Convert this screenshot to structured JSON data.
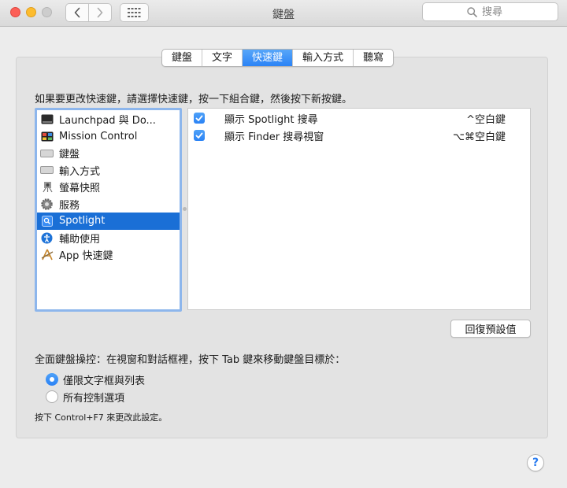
{
  "window": {
    "title": "鍵盤",
    "search_placeholder": "搜尋"
  },
  "tabs": [
    {
      "label": "鍵盤",
      "active": false
    },
    {
      "label": "文字",
      "active": false
    },
    {
      "label": "快速鍵",
      "active": true
    },
    {
      "label": "輸入方式",
      "active": false
    },
    {
      "label": "聽寫",
      "active": false
    }
  ],
  "instruction": "如果要更改快速鍵，請選擇快速鍵，按一下組合鍵，然後按下新按鍵。",
  "categories": [
    {
      "label": "Launchpad 與 Do...",
      "icon": "launchpad-icon",
      "selected": false
    },
    {
      "label": "Mission Control",
      "icon": "mission-control-icon",
      "selected": false
    },
    {
      "label": "鍵盤",
      "icon": "keyboard-icon",
      "selected": false
    },
    {
      "label": "輸入方式",
      "icon": "input-method-icon",
      "selected": false
    },
    {
      "label": "螢幕快照",
      "icon": "screenshot-icon",
      "selected": false
    },
    {
      "label": "服務",
      "icon": "services-gear-icon",
      "selected": false
    },
    {
      "label": "Spotlight",
      "icon": "spotlight-icon",
      "selected": true
    },
    {
      "label": "輔助使用",
      "icon": "accessibility-icon",
      "selected": false
    },
    {
      "label": "App 快速鍵",
      "icon": "app-shortcuts-icon",
      "selected": false
    }
  ],
  "shortcuts": [
    {
      "checked": true,
      "label": "顯示 Spotlight 搜尋",
      "key": "^空白鍵"
    },
    {
      "checked": true,
      "label": "顯示 Finder 搜尋視窗",
      "key": "⌥⌘空白鍵"
    }
  ],
  "restore_defaults_label": "回復預設值",
  "full_keyboard_access": {
    "label": "全面鍵盤操控：在視窗和對話框裡，按下 Tab 鍵來移動鍵盤目標於：",
    "options": [
      {
        "label": "僅限文字框與列表",
        "selected": true
      },
      {
        "label": "所有控制選項",
        "selected": false
      }
    ],
    "note": "按下 Control+F7 來更改此設定。"
  },
  "help_label": "?",
  "colors": {
    "accent": "#2b83f6",
    "selection": "#1a6fd6",
    "close": "#fc5f57",
    "minimize": "#fdbc2e"
  }
}
